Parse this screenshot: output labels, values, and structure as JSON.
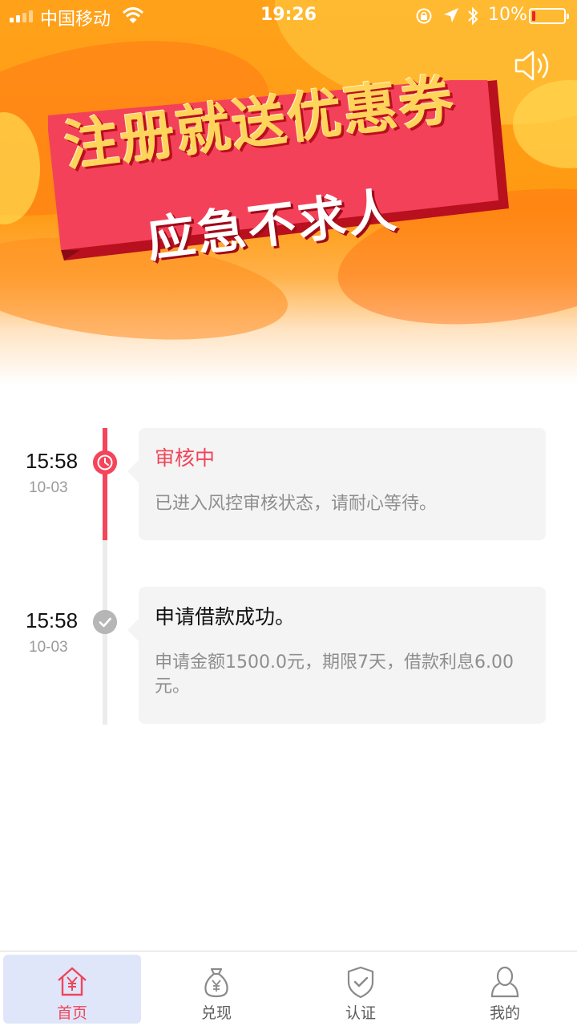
{
  "status_bar": {
    "carrier": "中国移动",
    "time": "19:26",
    "battery_percent": "10%",
    "battery_level": 0.1,
    "battery_color": "#e8262a",
    "icons": [
      "signal-icon",
      "wifi-icon",
      "rotation-lock-icon",
      "location-arrow-icon",
      "bluetooth-icon",
      "battery-icon"
    ]
  },
  "banner": {
    "title": "注册就送优惠券",
    "subtitle": "应急不求人",
    "sound_icon": "speaker-icon"
  },
  "timeline": {
    "items": [
      {
        "time": "15:58",
        "date": "10-03",
        "status_icon": "clock-icon",
        "title": "审核中",
        "description": "已进入风控审核状态，请耐心等待。",
        "active": true
      },
      {
        "time": "15:58",
        "date": "10-03",
        "status_icon": "check-icon",
        "title": "申请借款成功。",
        "description": "申请金额1500.0元，期限7天，借款利息6.00元。",
        "active": false
      }
    ]
  },
  "tabbar": {
    "items": [
      {
        "label": "首页",
        "icon": "home-yen-icon",
        "active": true
      },
      {
        "label": "兑现",
        "icon": "money-bag-icon",
        "active": false
      },
      {
        "label": "认证",
        "icon": "shield-check-icon",
        "active": false
      },
      {
        "label": "我的",
        "icon": "user-icon",
        "active": false
      }
    ]
  },
  "colors": {
    "accent": "#f0455a",
    "tab_active_bg": "#dfe6fa",
    "banner_orange": "#ff9a12"
  }
}
